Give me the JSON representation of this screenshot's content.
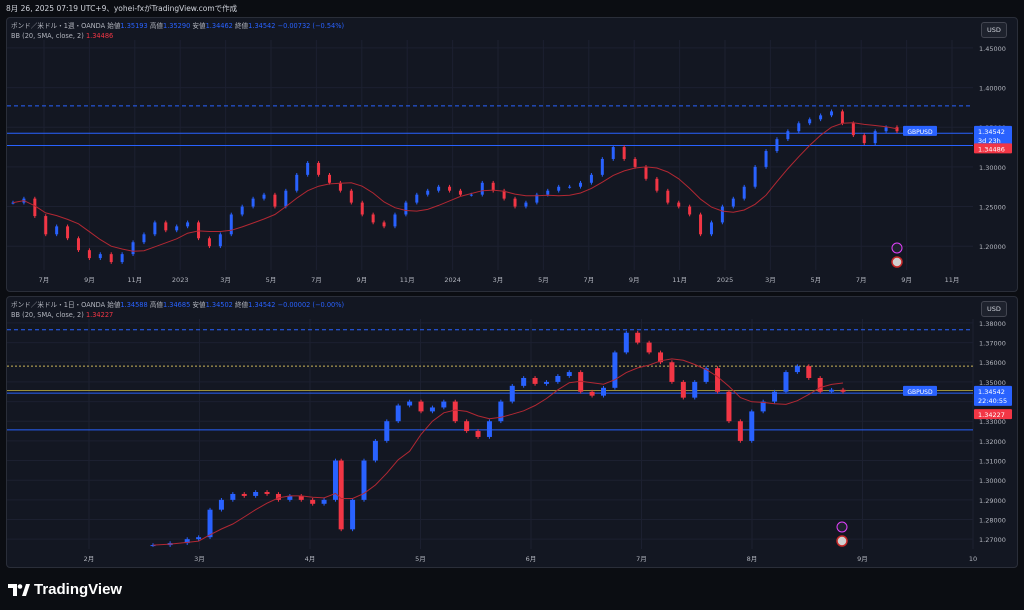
{
  "screenshot_caption": "8月 26, 2025 07:19 UTC+9、yohei-fxがTradingView.comで作成",
  "brand": "TradingView",
  "chart_data": [
    {
      "type": "candlestick",
      "symbol_title": "ポンド／米ドル・1週・OANDA",
      "ohlc": {
        "open_label": "始値",
        "open": "1.35193",
        "high_label": "高値",
        "high": "1.35290",
        "low_label": "安値",
        "low": "1.34462",
        "close_label": "終値",
        "close": "1.34542",
        "change": "−0.00732 (−0.54%)"
      },
      "indicator": {
        "label": "BB (20, SMA, close, 2)",
        "value": "1.34486"
      },
      "currency": "USD",
      "ylim": [
        1.17,
        1.46
      ],
      "y_ticks": [
        "1.45000",
        "1.40000",
        "1.35000",
        "1.30000",
        "1.25000",
        "1.20000"
      ],
      "x_ticks": [
        "7月",
        "9月",
        "11月",
        "2023",
        "3月",
        "5月",
        "7月",
        "9月",
        "11月",
        "2024",
        "3月",
        "5月",
        "7月",
        "9月",
        "11月",
        "2025",
        "3月",
        "5月",
        "7月",
        "9月",
        "11月"
      ],
      "price_tag": {
        "symbol": "GBPUSD",
        "price": "1.34542",
        "countdown": "3d 23h"
      },
      "bb_tag": "1.34486",
      "horizontal_lines": [
        {
          "value": 1.377,
          "style": "dashed"
        },
        {
          "value": 1.3425,
          "style": "solid"
        },
        {
          "value": 1.327,
          "style": "solid"
        }
      ],
      "close_path": [
        [
          0,
          1.255
        ],
        [
          6,
          1.26
        ],
        [
          12,
          1.238
        ],
        [
          18,
          1.215
        ],
        [
          24,
          1.225
        ],
        [
          30,
          1.21
        ],
        [
          36,
          1.195
        ],
        [
          42,
          1.185
        ],
        [
          48,
          1.19
        ],
        [
          54,
          1.18
        ],
        [
          60,
          1.19
        ],
        [
          66,
          1.205
        ],
        [
          72,
          1.215
        ],
        [
          78,
          1.23
        ],
        [
          84,
          1.22
        ],
        [
          90,
          1.225
        ],
        [
          96,
          1.23
        ],
        [
          102,
          1.21
        ],
        [
          108,
          1.2
        ],
        [
          114,
          1.215
        ],
        [
          120,
          1.24
        ],
        [
          126,
          1.25
        ],
        [
          132,
          1.26
        ],
        [
          138,
          1.265
        ],
        [
          144,
          1.25
        ],
        [
          150,
          1.27
        ],
        [
          156,
          1.29
        ],
        [
          162,
          1.305
        ],
        [
          168,
          1.29
        ],
        [
          174,
          1.28
        ],
        [
          180,
          1.27
        ],
        [
          186,
          1.255
        ],
        [
          192,
          1.24
        ],
        [
          198,
          1.23
        ],
        [
          204,
          1.225
        ],
        [
          210,
          1.24
        ],
        [
          216,
          1.255
        ],
        [
          222,
          1.265
        ],
        [
          228,
          1.27
        ],
        [
          234,
          1.275
        ],
        [
          240,
          1.27
        ],
        [
          246,
          1.265
        ],
        [
          252,
          1.265
        ],
        [
          258,
          1.28
        ],
        [
          264,
          1.27
        ],
        [
          270,
          1.26
        ],
        [
          276,
          1.25
        ],
        [
          282,
          1.255
        ],
        [
          288,
          1.265
        ],
        [
          294,
          1.27
        ],
        [
          300,
          1.275
        ],
        [
          306,
          1.275
        ],
        [
          312,
          1.28
        ],
        [
          318,
          1.29
        ],
        [
          324,
          1.31
        ],
        [
          330,
          1.325
        ],
        [
          336,
          1.31
        ],
        [
          342,
          1.3
        ],
        [
          348,
          1.285
        ],
        [
          354,
          1.27
        ],
        [
          360,
          1.255
        ],
        [
          366,
          1.25
        ],
        [
          372,
          1.24
        ],
        [
          378,
          1.215
        ],
        [
          384,
          1.23
        ],
        [
          390,
          1.25
        ],
        [
          396,
          1.26
        ],
        [
          402,
          1.275
        ],
        [
          408,
          1.3
        ],
        [
          414,
          1.32
        ],
        [
          420,
          1.335
        ],
        [
          426,
          1.345
        ],
        [
          432,
          1.355
        ],
        [
          438,
          1.36
        ],
        [
          444,
          1.365
        ],
        [
          450,
          1.37
        ],
        [
          456,
          1.355
        ],
        [
          462,
          1.34
        ],
        [
          468,
          1.33
        ],
        [
          474,
          1.345
        ],
        [
          480,
          1.35
        ],
        [
          486,
          1.345
        ]
      ]
    },
    {
      "type": "candlestick",
      "symbol_title": "ポンド／米ドル・1日・OANDA",
      "ohlc": {
        "open_label": "始値",
        "open": "1.34588",
        "high_label": "高値",
        "high": "1.34685",
        "low_label": "安値",
        "low": "1.34502",
        "close_label": "終値",
        "close": "1.34542",
        "change": "−0.00002 (−0.00%)"
      },
      "indicator": {
        "label": "BB (20, SMA, close, 2)",
        "value": "1.34227"
      },
      "currency": "USD",
      "ylim": [
        1.265,
        1.382
      ],
      "y_ticks": [
        "1.38000",
        "1.37000",
        "1.36000",
        "1.35000",
        "1.34000",
        "1.33000",
        "1.32000",
        "1.31000",
        "1.30000",
        "1.29000",
        "1.28000",
        "1.27000"
      ],
      "x_ticks": [
        "2月",
        "3月",
        "4月",
        "5月",
        "6月",
        "7月",
        "8月",
        "9月",
        "10"
      ],
      "price_tag": {
        "symbol": "GBPUSD",
        "price": "1.34542",
        "countdown": "22:40:55"
      },
      "bb_tag": "1.34227",
      "horizontal_lines": [
        {
          "value": 1.3765,
          "style": "dashed"
        },
        {
          "value": 1.358,
          "style": "dotted-yellow"
        },
        {
          "value": 1.3456,
          "style": "solid-yellow"
        },
        {
          "value": 1.3443,
          "style": "solid"
        },
        {
          "value": 1.3256,
          "style": "solid"
        }
      ],
      "close_path": [
        [
          0,
          1.267
        ],
        [
          6,
          1.268
        ],
        [
          12,
          1.27
        ],
        [
          16,
          1.271
        ],
        [
          20,
          1.285
        ],
        [
          24,
          1.29
        ],
        [
          28,
          1.293
        ],
        [
          32,
          1.292
        ],
        [
          36,
          1.294
        ],
        [
          40,
          1.293
        ],
        [
          44,
          1.29
        ],
        [
          48,
          1.292
        ],
        [
          52,
          1.29
        ],
        [
          56,
          1.288
        ],
        [
          60,
          1.29
        ],
        [
          64,
          1.31
        ],
        [
          66,
          1.275
        ],
        [
          70,
          1.29
        ],
        [
          74,
          1.31
        ],
        [
          78,
          1.32
        ],
        [
          82,
          1.33
        ],
        [
          86,
          1.338
        ],
        [
          90,
          1.34
        ],
        [
          94,
          1.335
        ],
        [
          98,
          1.337
        ],
        [
          102,
          1.34
        ],
        [
          106,
          1.33
        ],
        [
          110,
          1.325
        ],
        [
          114,
          1.322
        ],
        [
          118,
          1.33
        ],
        [
          122,
          1.34
        ],
        [
          126,
          1.348
        ],
        [
          130,
          1.352
        ],
        [
          134,
          1.349
        ],
        [
          138,
          1.35
        ],
        [
          142,
          1.353
        ],
        [
          146,
          1.355
        ],
        [
          150,
          1.345
        ],
        [
          154,
          1.343
        ],
        [
          158,
          1.347
        ],
        [
          162,
          1.365
        ],
        [
          166,
          1.375
        ],
        [
          170,
          1.37
        ],
        [
          174,
          1.365
        ],
        [
          178,
          1.36
        ],
        [
          182,
          1.35
        ],
        [
          186,
          1.342
        ],
        [
          190,
          1.35
        ],
        [
          194,
          1.357
        ],
        [
          198,
          1.345
        ],
        [
          202,
          1.33
        ],
        [
          206,
          1.32
        ],
        [
          210,
          1.335
        ],
        [
          214,
          1.34
        ],
        [
          218,
          1.345
        ],
        [
          222,
          1.355
        ],
        [
          226,
          1.358
        ],
        [
          230,
          1.352
        ],
        [
          234,
          1.345
        ],
        [
          238,
          1.346
        ],
        [
          242,
          1.345
        ]
      ]
    }
  ]
}
